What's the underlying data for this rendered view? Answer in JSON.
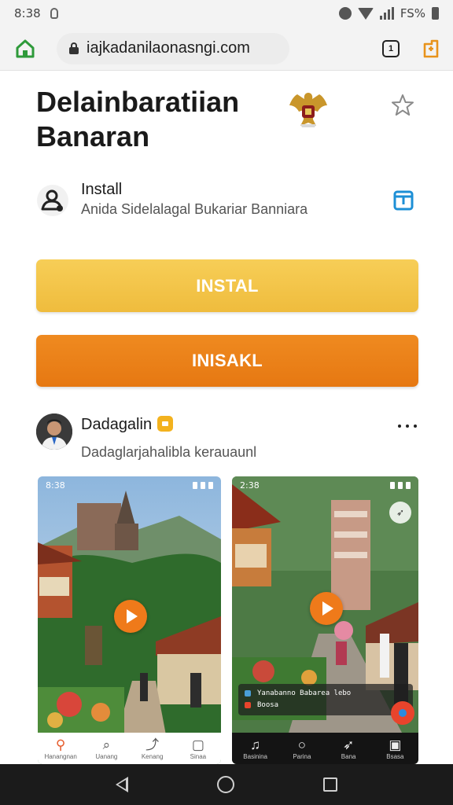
{
  "status_bar": {
    "time": "8:38",
    "battery_text": "FS%"
  },
  "browser": {
    "url": "iajkadanilaonasngi.com",
    "tabs_count": "1"
  },
  "app": {
    "title": "Delainbaratiian Banaran"
  },
  "install": {
    "title": "Install",
    "subtitle": "Anida Sidelalagal Bukariar Banniara"
  },
  "buttons": {
    "primary": "INSTAL",
    "secondary": "INISAKL"
  },
  "author": {
    "name": "Dadagalin",
    "subtitle": "Dadaglarjahalibla kerauaunl"
  },
  "screenshots": [
    {
      "status_time": "8:38",
      "nav": [
        {
          "icon": "map-pin-icon",
          "glyph": "⚲",
          "label": "Hanangnan"
        },
        {
          "icon": "search-icon",
          "glyph": "⌕",
          "label": "Uanang"
        },
        {
          "icon": "share-icon",
          "glyph": "⤴",
          "label": "Kenang"
        },
        {
          "icon": "square-icon",
          "glyph": "▢",
          "label": "Sinaa"
        }
      ]
    },
    {
      "status_time": "2:38",
      "card_lines": [
        "Yanabanno   Babarea lebo",
        "Boosa"
      ],
      "nav": [
        {
          "icon": "headphones-icon",
          "glyph": "♫",
          "label": "Basinina"
        },
        {
          "icon": "circle-icon",
          "glyph": "○",
          "label": "Parina"
        },
        {
          "icon": "bird-icon",
          "glyph": "➶",
          "label": "Bana"
        },
        {
          "icon": "t-square-icon",
          "glyph": "▣",
          "label": "Bsasa"
        }
      ]
    }
  ]
}
